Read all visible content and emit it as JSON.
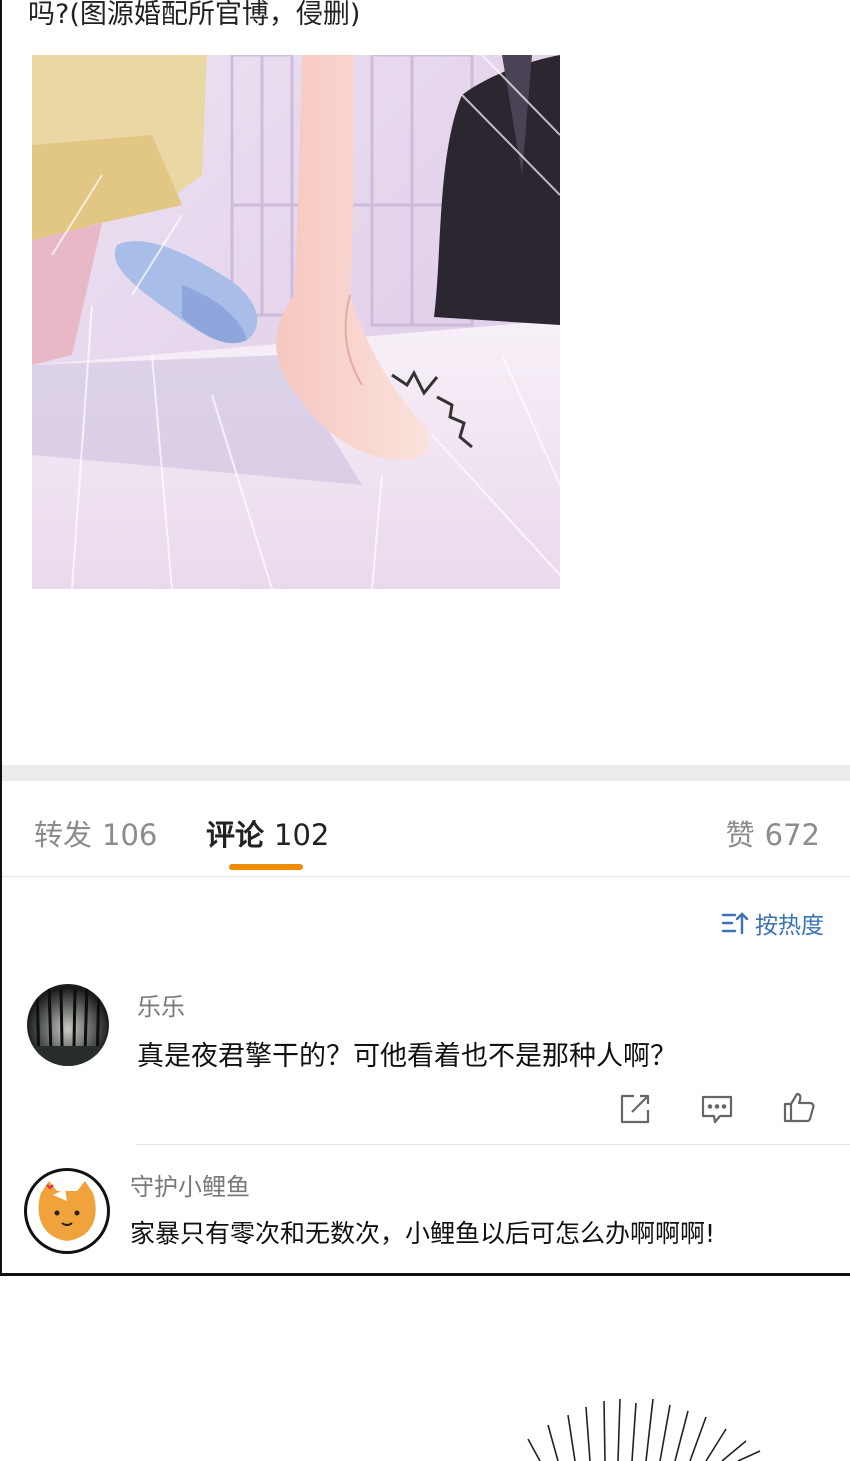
{
  "post": {
    "caption": "吗?(图源婚配所官博，侵删)"
  },
  "tabs": {
    "repost_label": "转发",
    "repost_count": "106",
    "comment_label": "评论",
    "comment_count": "102",
    "like_label": "赞",
    "like_count": "672"
  },
  "sort": {
    "label": "按热度",
    "icon": "sort-icon"
  },
  "comments": [
    {
      "user": "乐乐",
      "text": "真是夜君擎干的？可他看着也不是那种人啊？",
      "avatar": "dark-forest-avatar",
      "actions": [
        "share-icon",
        "comment-icon",
        "like-icon"
      ]
    },
    {
      "user": "守护小鲤鱼",
      "text": "家暴只有零次和无数次，小鲤鱼以后可怎么办啊啊啊!",
      "avatar": "orange-cat-avatar"
    }
  ],
  "colors": {
    "accent_orange": "#f08c00",
    "link_blue": "#3a72b5",
    "muted_gray": "#8c8c8c"
  }
}
